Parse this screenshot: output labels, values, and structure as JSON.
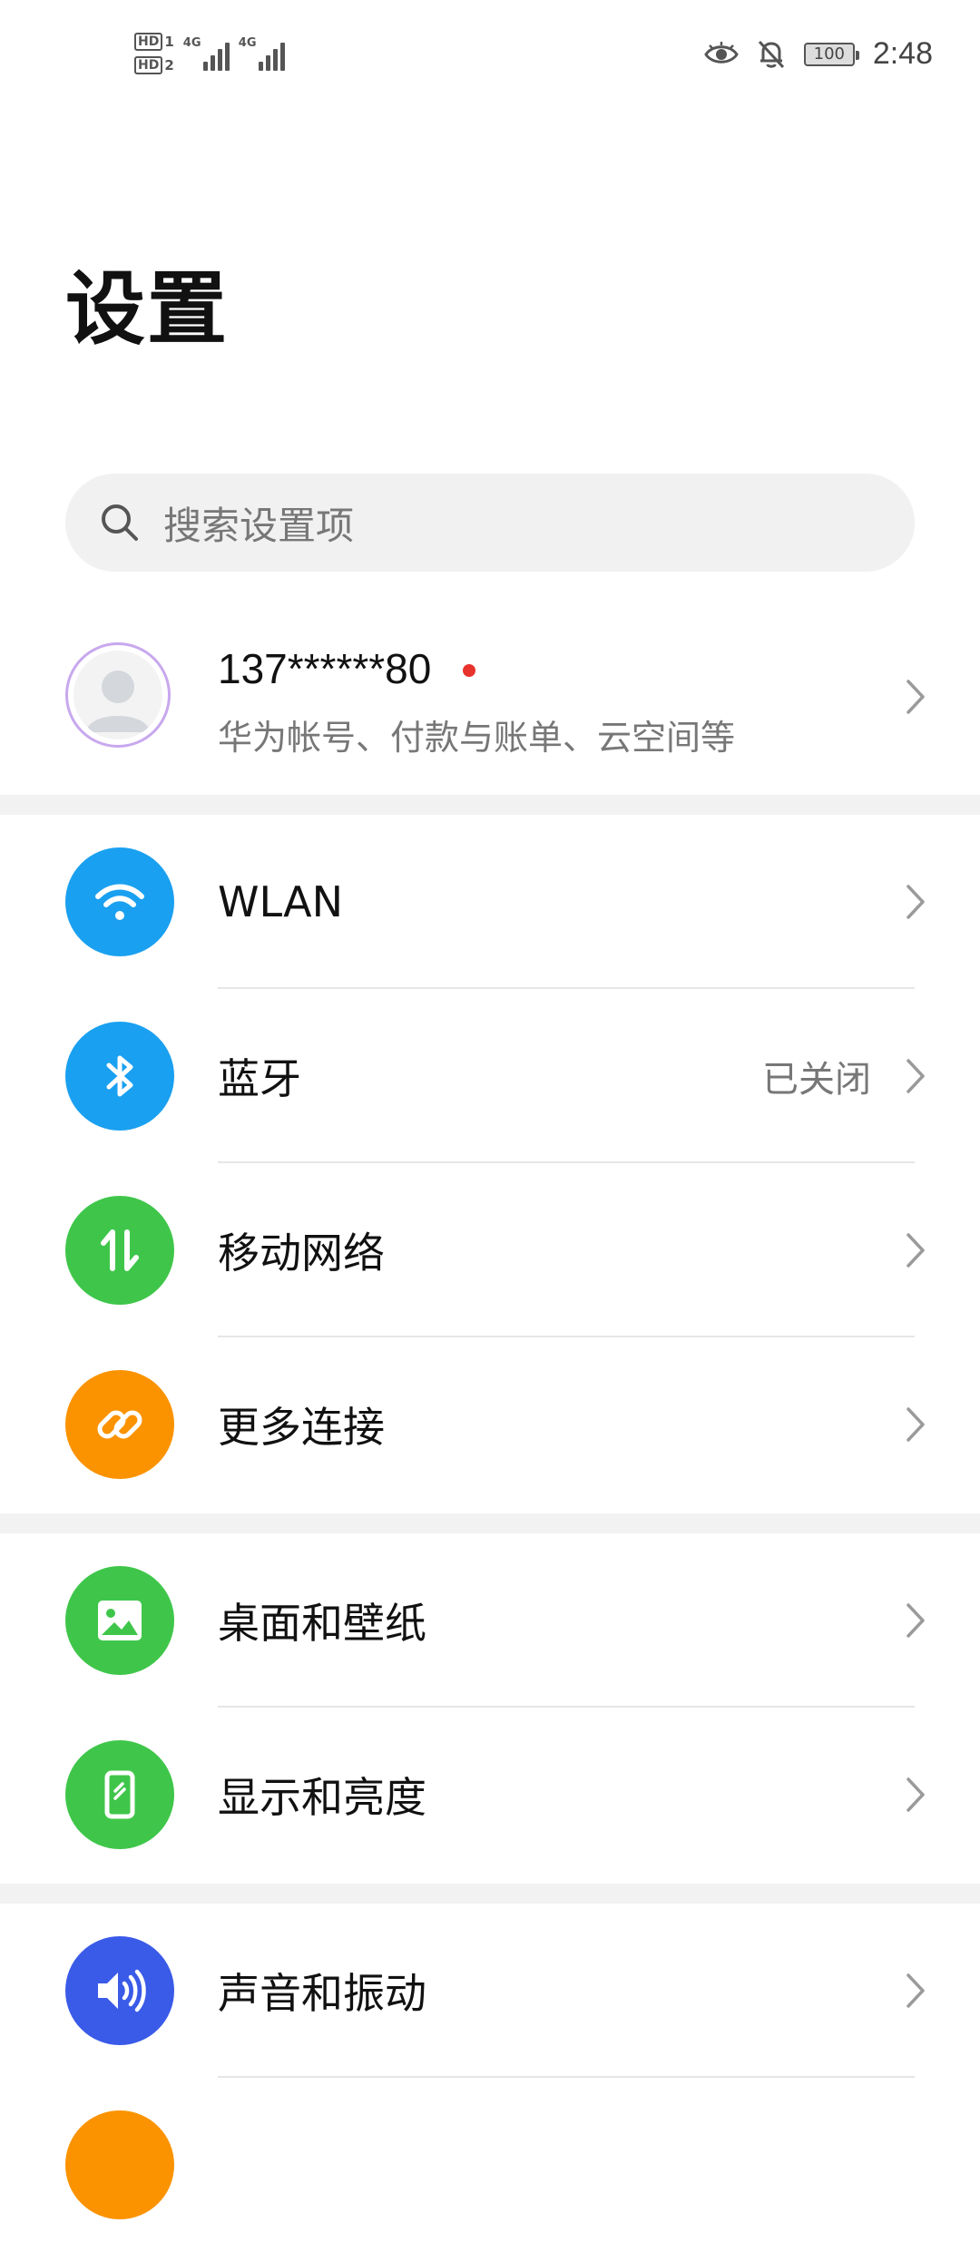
{
  "status_bar": {
    "sim1": "HD",
    "sim1_slot": "1",
    "sim2": "HD",
    "sim2_slot": "2",
    "network1": "4G",
    "network2": "4G",
    "icons": [
      "eye-icon",
      "bell-off-icon"
    ],
    "battery": "100",
    "time": "2:48"
  },
  "page": {
    "title": "设置"
  },
  "search": {
    "placeholder": "搜索设置项"
  },
  "account": {
    "name": "137******80",
    "subtitle": "华为帐号、付款与账单、云空间等"
  },
  "groups": [
    {
      "items": [
        {
          "label": "WLAN",
          "value": "",
          "icon": "wifi-icon",
          "color": "#1aa0f0"
        },
        {
          "label": "蓝牙",
          "value": "已关闭",
          "icon": "bluetooth-icon",
          "color": "#1aa0f0"
        },
        {
          "label": "移动网络",
          "value": "",
          "icon": "mobile-data-icon",
          "color": "#3fc64a"
        },
        {
          "label": "更多连接",
          "value": "",
          "icon": "link-icon",
          "color": "#fb9300"
        }
      ]
    },
    {
      "items": [
        {
          "label": "桌面和壁纸",
          "value": "",
          "icon": "image-icon",
          "color": "#3fc64a"
        },
        {
          "label": "显示和亮度",
          "value": "",
          "icon": "display-icon",
          "color": "#3fc64a"
        }
      ]
    },
    {
      "items": [
        {
          "label": "声音和振动",
          "value": "",
          "icon": "volume-icon",
          "color": "#3a5ae8"
        }
      ]
    }
  ]
}
